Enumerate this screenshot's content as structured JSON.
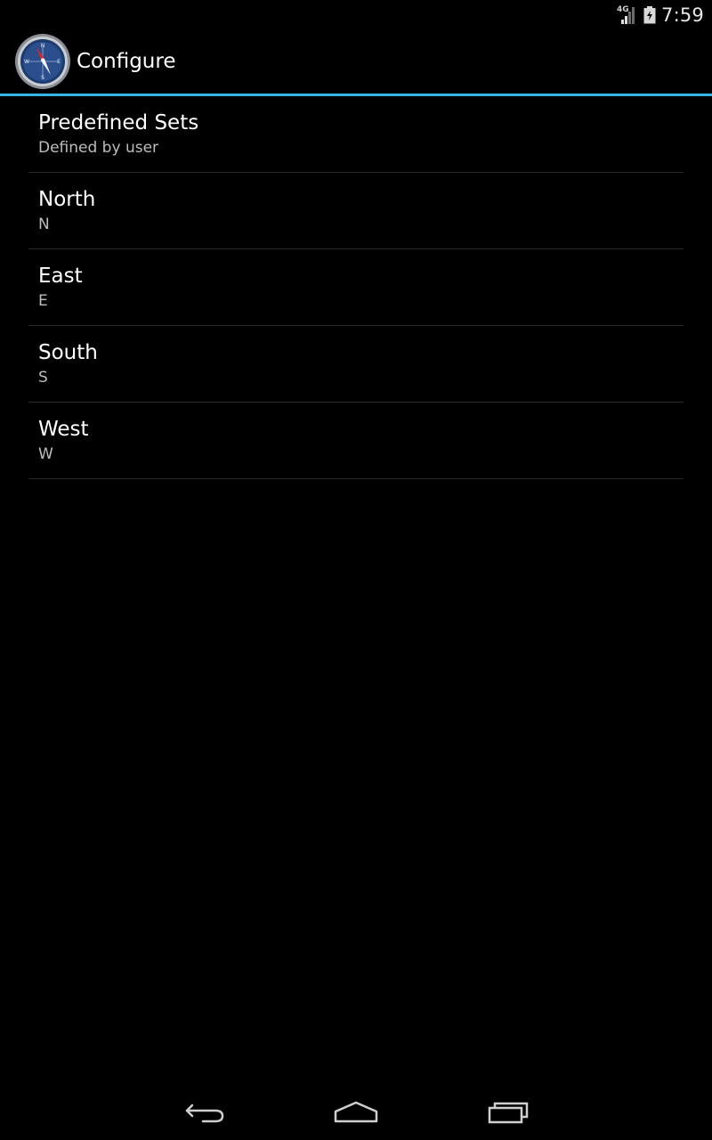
{
  "status_bar": {
    "network_label": "4G",
    "time": "7:59"
  },
  "action_bar": {
    "app_icon": "compass-icon",
    "title": "Configure",
    "accent_color": "#33b5e5"
  },
  "preferences": [
    {
      "title": "Predefined Sets",
      "summary": "Defined by user"
    },
    {
      "title": "North",
      "summary": "N"
    },
    {
      "title": "East",
      "summary": "E"
    },
    {
      "title": "South",
      "summary": "S"
    },
    {
      "title": "West",
      "summary": "W"
    }
  ],
  "nav_bar": {
    "back_icon": "back-icon",
    "home_icon": "home-icon",
    "recents_icon": "recent-apps-icon"
  }
}
